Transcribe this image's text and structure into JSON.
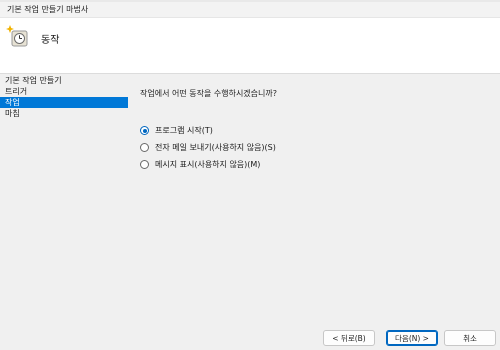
{
  "window": {
    "title": "기본 작업 만들기 마법사"
  },
  "header": {
    "heading": "동작"
  },
  "steps": [
    {
      "label": "기본 작업 만들기",
      "active": false
    },
    {
      "label": "트리거",
      "active": false
    },
    {
      "label": "작업",
      "active": true
    },
    {
      "label": "마침",
      "active": false
    }
  ],
  "main": {
    "prompt": "작업에서 어떤 동작을 수행하시겠습니까?",
    "options": [
      {
        "label": "프로그램 시작(T)",
        "checked": true
      },
      {
        "label": "전자 메일 보내기(사용하지 않음)(S)",
        "checked": false
      },
      {
        "label": "메시지 표시(사용하지 않음)(M)",
        "checked": false
      }
    ]
  },
  "buttons": {
    "back": "< 뒤로(B)",
    "next": "다음(N) >",
    "cancel": "취소"
  },
  "colors": {
    "accent": "#0078d7",
    "radio": "#0067c0"
  },
  "icons": {
    "wizard": "clock-sparkle-icon"
  }
}
